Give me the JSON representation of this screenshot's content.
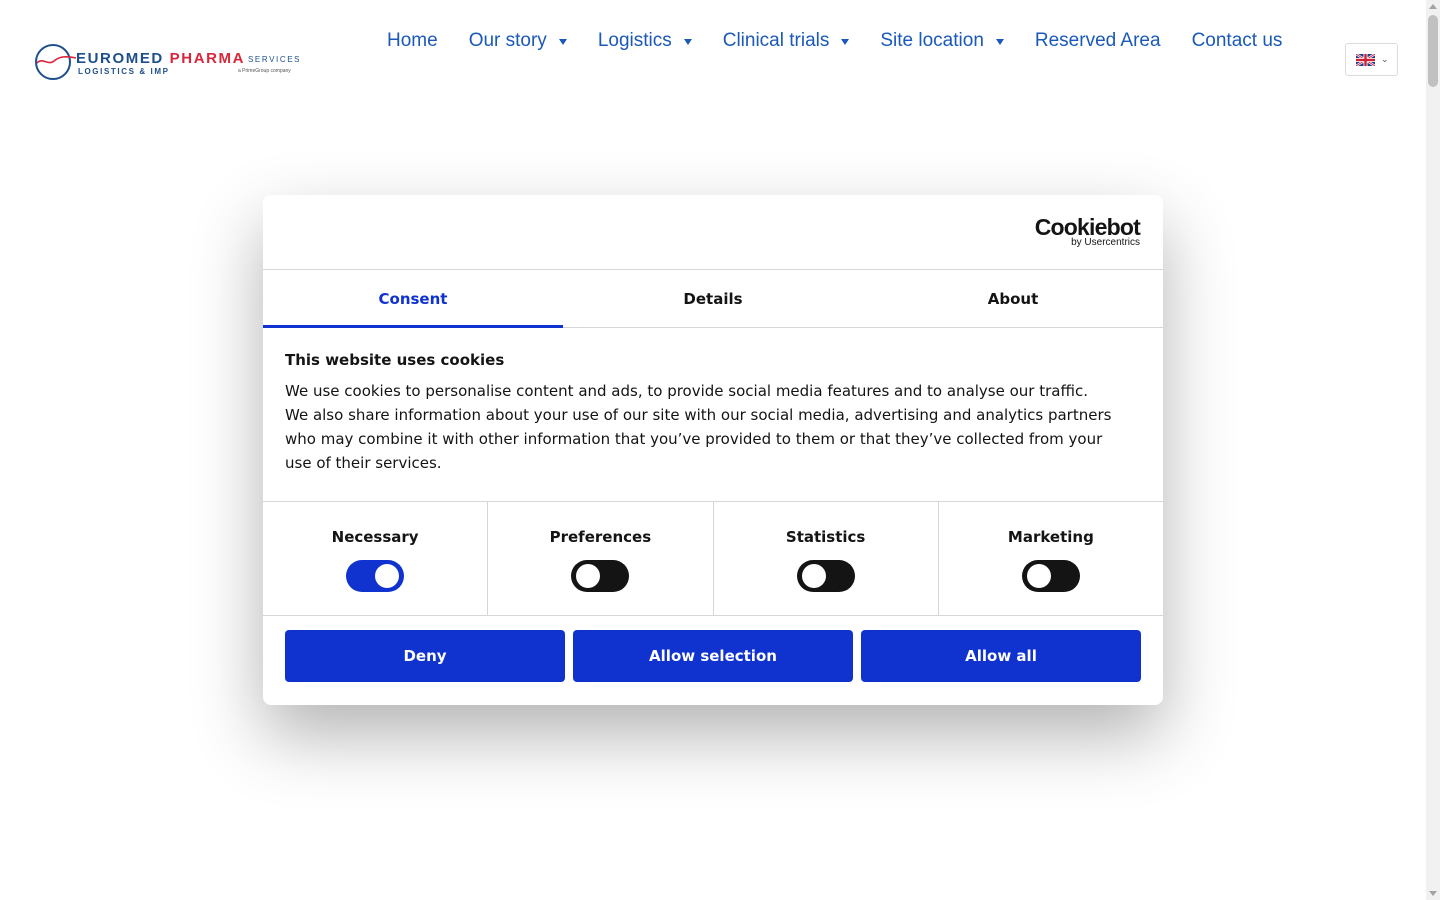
{
  "header": {
    "logo": {
      "brand_part1": "EUROMED",
      "brand_part2": "PHARMA",
      "services": "SERVICES",
      "tagline": "LOGISTICS & IMP",
      "company_note": "a PrimeGroup company"
    },
    "nav": [
      {
        "label": "Home",
        "has_dropdown": false
      },
      {
        "label": "Our story",
        "has_dropdown": true
      },
      {
        "label": "Logistics",
        "has_dropdown": true
      },
      {
        "label": "Clinical trials",
        "has_dropdown": true
      },
      {
        "label": "Site location",
        "has_dropdown": true
      },
      {
        "label": "Reserved Area",
        "has_dropdown": false
      },
      {
        "label": "Contact us",
        "has_dropdown": false
      }
    ],
    "language": {
      "icon": "uk-flag-icon",
      "selected": "English"
    }
  },
  "cookie_dialog": {
    "provider": {
      "name": "Cookiebot",
      "byline": "by Usercentrics"
    },
    "tabs": [
      {
        "label": "Consent",
        "active": true
      },
      {
        "label": "Details",
        "active": false
      },
      {
        "label": "About",
        "active": false
      }
    ],
    "title": "This website uses cookies",
    "description": "We use cookies to personalise content and ads, to provide social media features and to analyse our traffic. We also share information about your use of our site with our social media, advertising and analytics partners who may combine it with other information that you’ve provided to them or that they’ve collected from your use of their services.",
    "categories": [
      {
        "label": "Necessary",
        "enabled": true
      },
      {
        "label": "Preferences",
        "enabled": false
      },
      {
        "label": "Statistics",
        "enabled": false
      },
      {
        "label": "Marketing",
        "enabled": false
      }
    ],
    "buttons": {
      "deny": "Deny",
      "allow_selection": "Allow selection",
      "allow_all": "Allow all"
    }
  },
  "colors": {
    "nav_text": "#1a59b8",
    "accent": "#1032cf",
    "brand_blue": "#1e4f8c",
    "brand_red": "#d8263a",
    "toggle_off": "#141414"
  }
}
